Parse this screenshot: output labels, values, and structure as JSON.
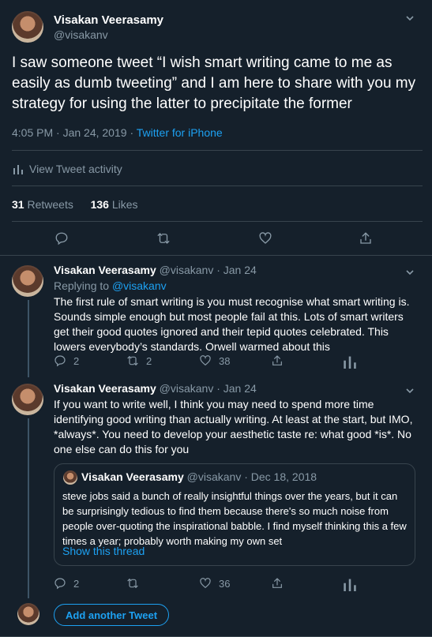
{
  "main_tweet": {
    "author_name": "Visakan Veerasamy",
    "author_handle": "@visakanv",
    "text": "I saw someone tweet “I wish smart writing came to me as easily as dumb tweeting” and I am here to share with you my strategy for using the latter to precipitate the former",
    "time": "4:05 PM · Jan 24, 2019",
    "separator": "·",
    "source": "Twitter for iPhone",
    "activity_label": "View Tweet activity",
    "retweets_count": "31",
    "retweets_label": "Retweets",
    "likes_count": "136",
    "likes_label": "Likes"
  },
  "replies": [
    {
      "author_name": "Visakan Veerasamy",
      "author_handle": "@visakanv",
      "date": "· Jan 24",
      "replying_prefix": "Replying to",
      "replying_to": "@visakanv",
      "text": "The first rule of smart writing is you must recognise what smart writing is. Sounds simple enough but most people fail at this. Lots of smart writers get their good quotes ignored and their tepid quotes celebrated. This lowers everybody’s standards. Orwell warmed about this",
      "replies": "2",
      "retweets": "2",
      "likes": "38"
    },
    {
      "author_name": "Visakan Veerasamy",
      "author_handle": "@visakanv",
      "date": "· Jan 24",
      "text": "If you want to write well, I think you may need to spend more time identifying good writing than actually writing. At least at the start, but IMO, *always*. You need to develop your aesthetic taste re: what good *is*. No one else can do this for you",
      "quote": {
        "author_name": "Visakan Veerasamy",
        "author_handle": "@visakanv",
        "date": "· Dec 18, 2018",
        "text": "steve jobs said a bunch of really insightful things over the years, but it can be surprisingly tedious to find them because there's so much noise from people over-quoting the inspirational babble. I find myself thinking this a few times a year; probably worth making my own set",
        "show_thread": "Show this thread"
      },
      "replies": "2",
      "retweets": "",
      "likes": "36"
    }
  ],
  "composer": {
    "add_label": "Add another Tweet"
  },
  "colors": {
    "background": "#15202b",
    "accent": "#1da1f2",
    "muted": "#8899a6",
    "border": "#38444d"
  }
}
